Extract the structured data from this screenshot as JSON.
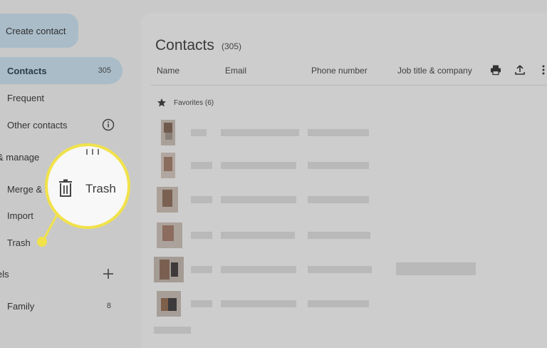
{
  "sidebar": {
    "create_label": "Create contact",
    "items": [
      {
        "label": "Contacts",
        "count": "305"
      },
      {
        "label": "Frequent"
      },
      {
        "label": "Other contacts"
      }
    ],
    "fix_manage_label": "& manage",
    "manage_items": [
      {
        "label": "Merge & f"
      },
      {
        "label": "Import"
      },
      {
        "label": "Trash"
      }
    ],
    "labels_label": "els",
    "label_items": [
      {
        "label": "Family",
        "count": "8"
      }
    ]
  },
  "main": {
    "title": "Contacts",
    "title_count": "(305)",
    "columns": [
      "Name",
      "Email",
      "Phone number",
      "Job title & company"
    ],
    "favorites_label": "Favorites (6)"
  },
  "magnifier": {
    "label": "Trash",
    "icon": "trash-icon",
    "accent": "#f1e24a"
  },
  "colors": {
    "active_nav": "#a9bcc8",
    "background": "#c9c9c9"
  }
}
